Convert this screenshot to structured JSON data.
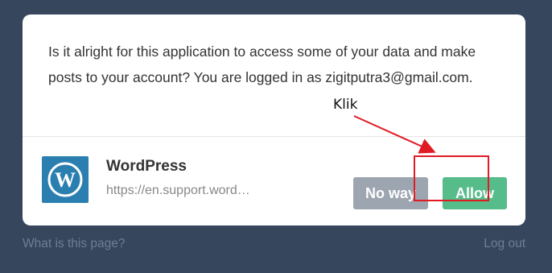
{
  "dialog": {
    "message": "Is it alright for this application to access some of your data and make posts to your account? You are logged in as zigitputra3@gmail.com.",
    "app": {
      "name": "WordPress",
      "url": "https://en.support.word…",
      "logo_icon": "wordpress-logo-icon"
    },
    "buttons": {
      "deny_label": "No way",
      "allow_label": "Allow"
    }
  },
  "annotation": {
    "label": "Klik",
    "color": "#e01b24"
  },
  "footer": {
    "help_link": "What is this page?",
    "logout_link": "Log out"
  },
  "colors": {
    "background": "#36465d",
    "allow": "#56bc8a",
    "deny": "#9da6b0",
    "logo": "#2b7fb0"
  }
}
